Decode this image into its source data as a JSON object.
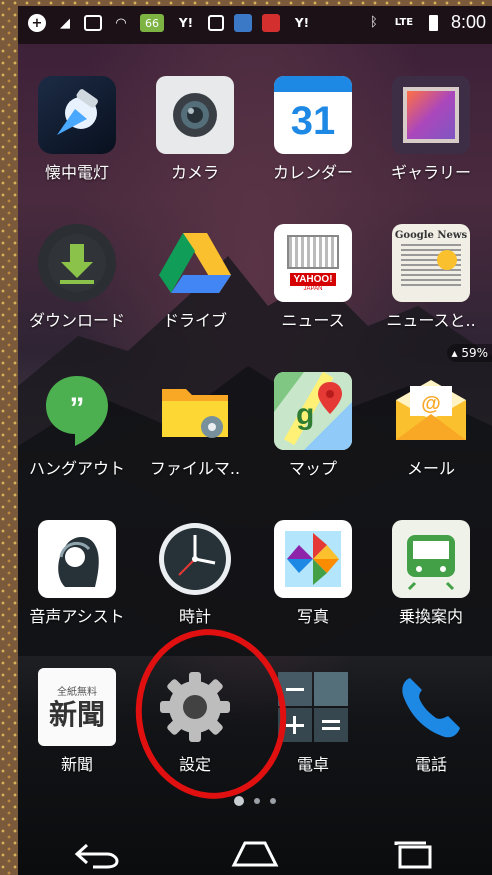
{
  "status_bar": {
    "time": "8:00",
    "notification_badge": "66",
    "yahoo_icon_label": "Y!",
    "signal_label": "LTE",
    "battery_percent": "59%"
  },
  "apps": [
    {
      "label": "懐中電灯"
    },
    {
      "label": "カメラ"
    },
    {
      "label": "カレンダー",
      "calendar_day": "31"
    },
    {
      "label": "ギャラリー"
    },
    {
      "label": "ダウンロード"
    },
    {
      "label": "ドライブ"
    },
    {
      "label": "ニュース",
      "yahoo_text": "YAHOO!",
      "yahoo_sub": "JAPAN"
    },
    {
      "label": "ニュースと..",
      "google_news_text": "Google News"
    },
    {
      "label": "ハングアウト"
    },
    {
      "label": "ファイルマ.."
    },
    {
      "label": "マップ"
    },
    {
      "label": "メール"
    },
    {
      "label": "音声アシスト"
    },
    {
      "label": "時計"
    },
    {
      "label": "写真"
    },
    {
      "label": "乗換案内"
    },
    {
      "label": "新聞",
      "top_text": "全紙無料",
      "big_text": "新聞"
    },
    {
      "label": "設定"
    },
    {
      "label": "電卓"
    },
    {
      "label": "電話"
    }
  ],
  "page_indicator": {
    "pages": 3,
    "active": 1
  },
  "navigation": {
    "back": "back-icon",
    "home": "home-icon",
    "recents": "recents-icon"
  },
  "colors": {
    "annotation_circle": "#e01010",
    "launcher_text": "#ffffff"
  }
}
